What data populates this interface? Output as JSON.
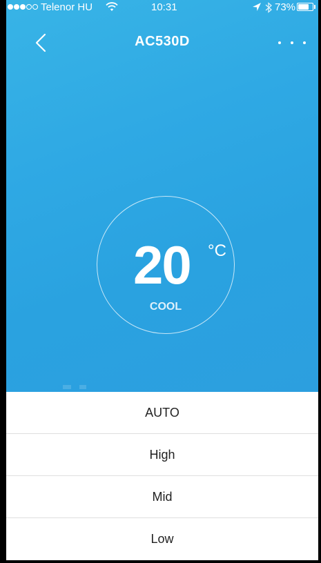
{
  "status_bar": {
    "carrier": "Telenor HU",
    "time": "10:31",
    "battery_percent": "73%",
    "battery_level": 0.73,
    "signal_bars_filled": 3,
    "signal_bars_total": 5,
    "icons": [
      "wifi-icon",
      "location-arrow-icon",
      "bluetooth-icon",
      "battery-icon"
    ]
  },
  "header": {
    "title": "AC530D",
    "back_icon": "chevron-left-icon",
    "more_icon": "more-dots-icon"
  },
  "thermostat": {
    "temperature": "20",
    "unit": "°C",
    "mode": "COOL"
  },
  "fan_speed_options": [
    "AUTO",
    "High",
    "Mid",
    "Low"
  ],
  "colors": {
    "accent": "#2fa9e4",
    "text_on_accent": "#ffffff",
    "option_text": "#222222",
    "divider": "#dedede"
  }
}
